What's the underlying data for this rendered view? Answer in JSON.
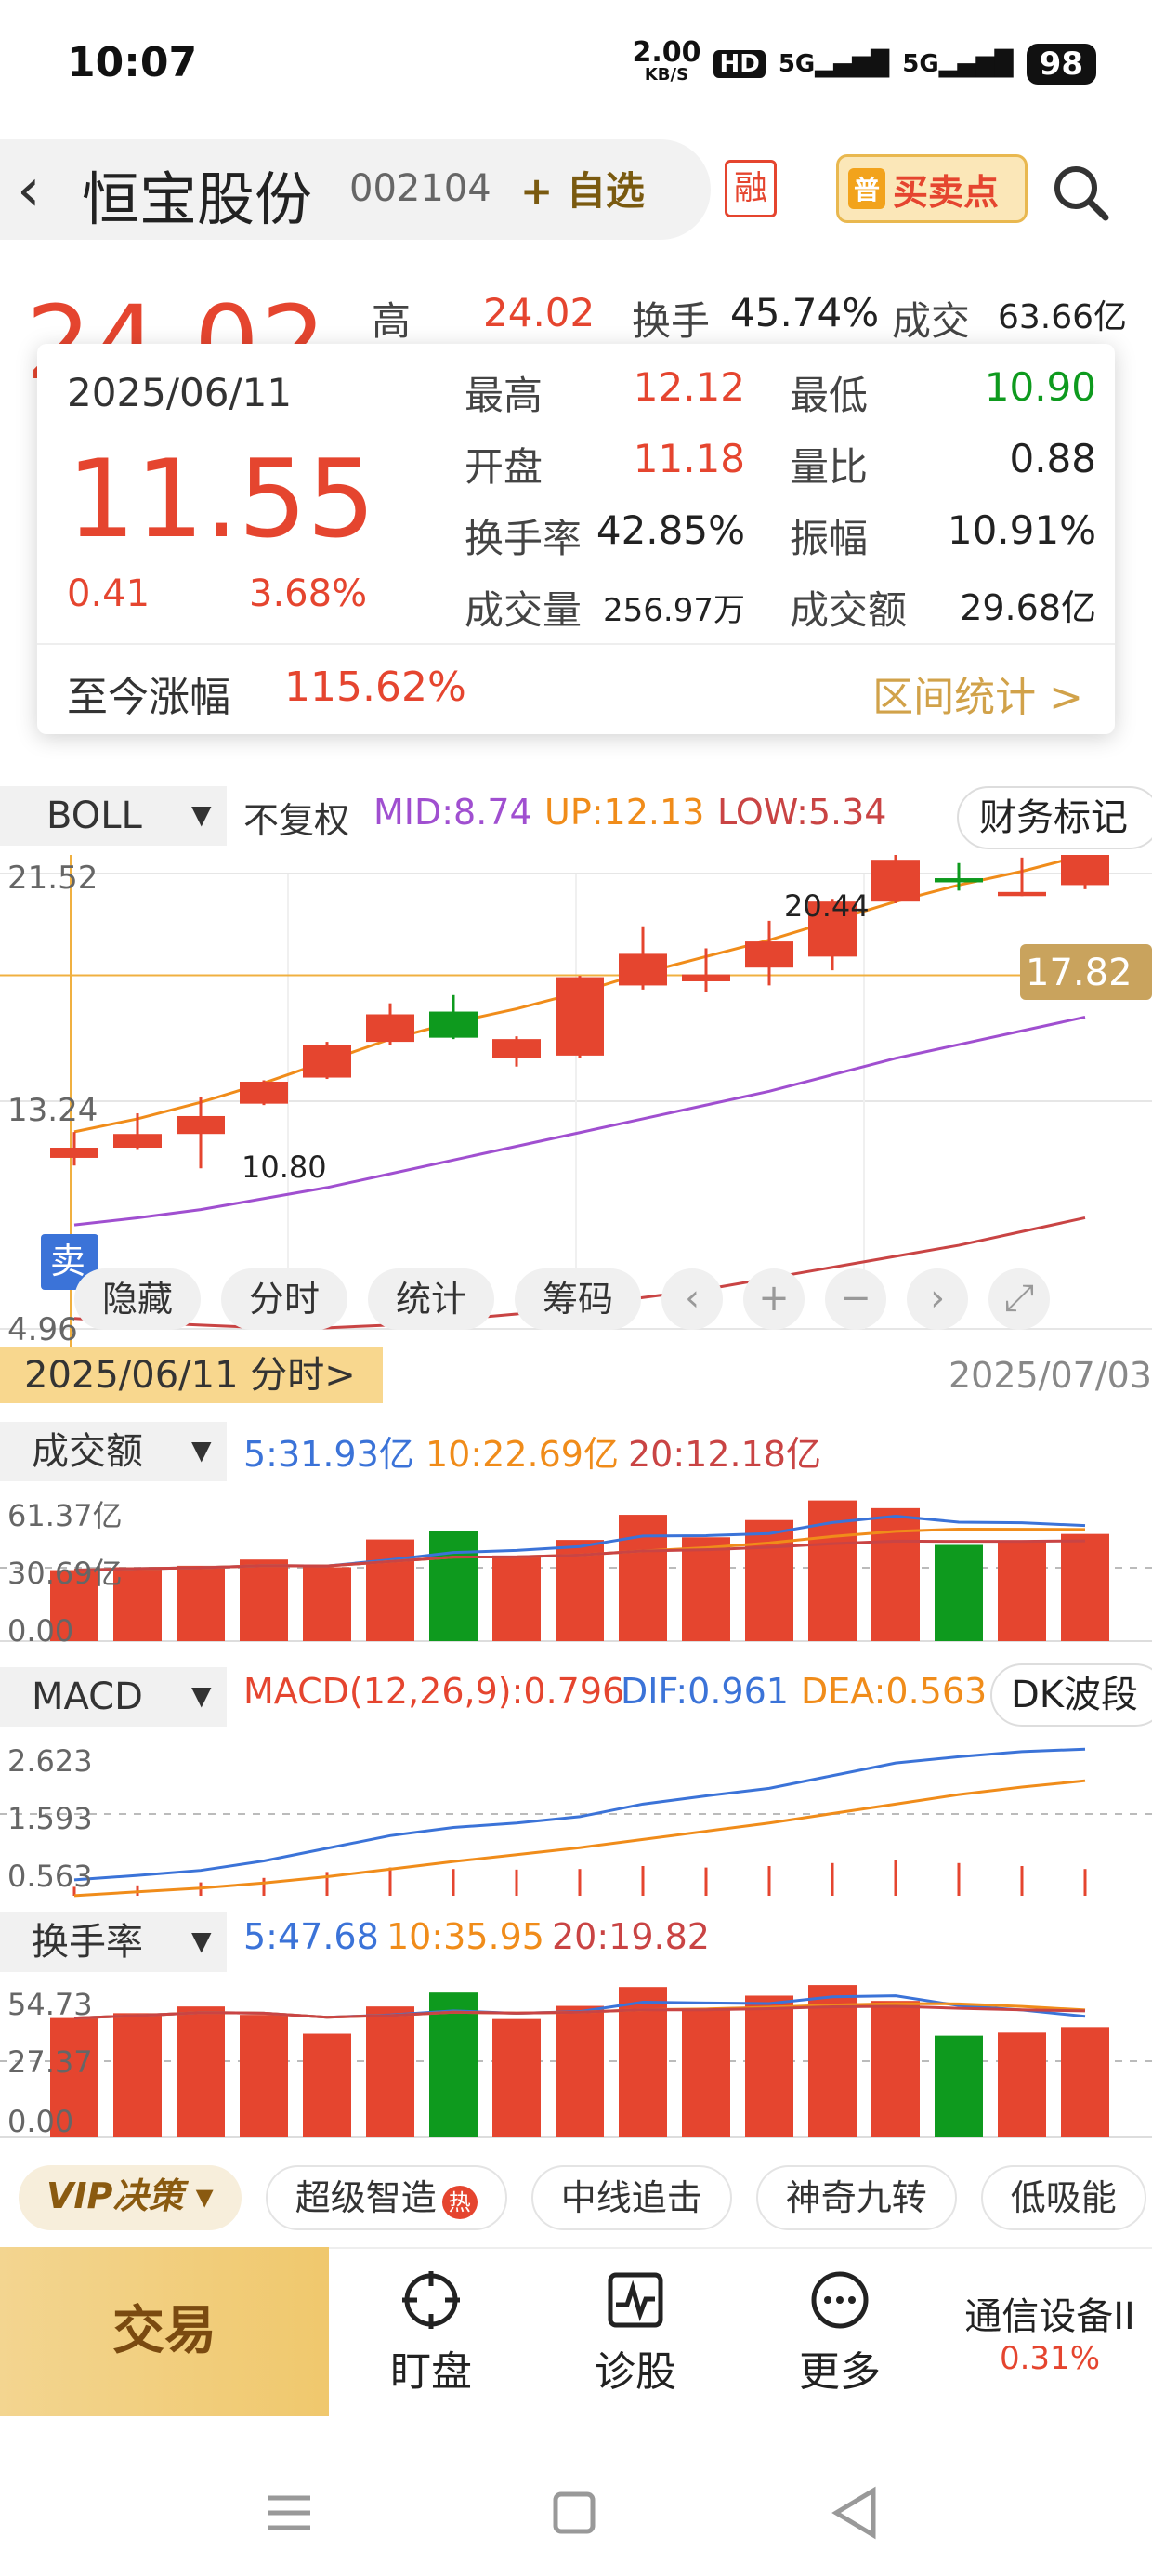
{
  "status": {
    "time": "10:07",
    "net_speed": "2.00",
    "net_unit": "KB/S",
    "hd": "HD",
    "sig1": "5G",
    "sig2": "5G",
    "battery": "98"
  },
  "header": {
    "name": "恒宝股份",
    "code": "002104",
    "watch_label": "+ 自选",
    "rong": "融",
    "buysell_badge": "普",
    "buysell_label": "买卖点"
  },
  "quote": {
    "price_bg": "24.02",
    "high_label": "高",
    "high_value": "24.02",
    "turnover_label": "换手",
    "turnover_value": "45.74%",
    "volume_label": "成交",
    "volume_value": "63.66亿"
  },
  "popup": {
    "date": "2025/06/11",
    "price": "11.55",
    "change": "0.41",
    "change_pct": "3.68%",
    "rows": [
      {
        "l1": "最高",
        "v1": "12.12",
        "l2": "最低",
        "v2": "10.90"
      },
      {
        "l1": "开盘",
        "v1": "11.18",
        "l2": "量比",
        "v2": "0.88"
      },
      {
        "l1": "换手率",
        "v1": "42.85%",
        "l2": "振幅",
        "v2": "10.91%"
      },
      {
        "l1": "成交量",
        "v1": "256.97万",
        "l2": "成交额",
        "v2": "29.68亿"
      }
    ],
    "since_label": "至今涨幅",
    "since_value": "115.62%",
    "range_label": "区间统计 >"
  },
  "indicator": {
    "name": "BOLL",
    "adj": "不复权",
    "mid": "MID:8.74",
    "up": "UP:12.13",
    "low": "LOW:5.34",
    "finance_btn": "财务标记"
  },
  "kline": {
    "y_top": "21.52",
    "y_mid": "13.24",
    "y_bottom": "4.96",
    "high_mark": "20.44",
    "low_mark": "10.80",
    "current_price": "17.82",
    "sell_mark": "卖"
  },
  "controls": [
    "隐藏",
    "分时",
    "统计",
    "筹码"
  ],
  "period": {
    "start_tab": "2025/06/11 分时>",
    "end_date": "2025/07/03"
  },
  "volume_panel": {
    "name": "成交额",
    "ma5": "5:31.93亿",
    "ma10": "10:22.69亿",
    "ma20": "20:12.18亿",
    "y_top": "61.37亿",
    "y_mid": "30.69亿",
    "y_zero": "0.00"
  },
  "macd_panel": {
    "name": "MACD",
    "macd": "MACD(12,26,9):0.796",
    "dif": "DIF:0.961",
    "dea": "DEA:0.563",
    "dk_btn": "DK波段",
    "y_top": "2.623",
    "y_mid": "1.593",
    "y_bottom": "0.563"
  },
  "turnover_panel": {
    "name": "换手率",
    "ma5": "5:47.68",
    "ma10": "10:35.95",
    "ma20": "20:19.82",
    "y_top": "54.73",
    "y_mid": "27.37",
    "y_zero": "0.00"
  },
  "features": {
    "vip": "VIP决策",
    "items": [
      "超级智造",
      "中线追击",
      "神奇九转",
      "低吸能"
    ],
    "hot": "热"
  },
  "bottom_nav": {
    "trade": "交易",
    "items": [
      "盯盘",
      "诊股",
      "更多"
    ],
    "sector_name": "通信设备II",
    "sector_pct": "0.31%"
  },
  "colors": {
    "up": "#e5452f",
    "down": "#0e9a1e",
    "boll_up": "#f08c1a",
    "boll_mid": "#a04fd0",
    "boll_low": "#c94444",
    "ma_blue": "#3b73d8"
  },
  "chart_data": {
    "type": "candlestick",
    "dates": [
      "2025/06/11",
      "2025/07/03"
    ],
    "candles": [
      {
        "o": 11.18,
        "c": 11.55,
        "h": 12.12,
        "l": 10.9
      },
      {
        "o": 11.55,
        "c": 12.05,
        "h": 12.8,
        "l": 11.5
      },
      {
        "o": 12.05,
        "c": 12.7,
        "h": 13.4,
        "l": 10.8
      },
      {
        "o": 13.15,
        "c": 13.95,
        "h": 14.0,
        "l": 13.1
      },
      {
        "o": 14.1,
        "c": 15.3,
        "h": 15.4,
        "l": 14.05
      },
      {
        "o": 15.4,
        "c": 16.4,
        "h": 16.8,
        "l": 15.3
      },
      {
        "o": 16.5,
        "c": 15.55,
        "h": 17.1,
        "l": 15.5
      },
      {
        "o": 14.8,
        "c": 15.5,
        "h": 15.6,
        "l": 14.5
      },
      {
        "o": 14.9,
        "c": 17.75,
        "h": 17.8,
        "l": 14.8
      },
      {
        "o": 17.45,
        "c": 18.6,
        "h": 19.6,
        "l": 17.3
      },
      {
        "o": 17.6,
        "c": 17.85,
        "h": 18.8,
        "l": 17.2
      },
      {
        "o": 18.1,
        "c": 19.05,
        "h": 19.8,
        "l": 17.45
      },
      {
        "o": 18.5,
        "c": 20.5,
        "h": 20.6,
        "l": 18.0
      },
      {
        "o": 20.5,
        "c": 22.02,
        "h": 22.5,
        "l": 20.44
      },
      {
        "o": 21.35,
        "c": 21.2,
        "h": 21.9,
        "l": 20.9
      },
      {
        "o": 20.7,
        "c": 20.85,
        "h": 22.1,
        "l": 20.7
      },
      {
        "o": 21.1,
        "c": 22.25,
        "h": 22.3,
        "l": 20.95
      }
    ],
    "boll_up": [
      12.13,
      12.6,
      13.2,
      13.9,
      14.7,
      15.5,
      16.1,
      16.6,
      17.2,
      17.9,
      18.5,
      19.1,
      19.8,
      20.5,
      21.1,
      21.6,
      22.2
    ],
    "boll_mid": [
      8.74,
      9.0,
      9.3,
      9.7,
      10.1,
      10.6,
      11.1,
      11.6,
      12.1,
      12.6,
      13.1,
      13.6,
      14.2,
      14.8,
      15.3,
      15.8,
      16.3
    ],
    "boll_low": [
      5.34,
      5.2,
      5.1,
      5.0,
      5.0,
      5.1,
      5.3,
      5.5,
      5.8,
      6.1,
      6.4,
      6.8,
      7.2,
      7.6,
      8.0,
      8.5,
      9.0
    ],
    "ylim": [
      4.96,
      21.52
    ],
    "volume": {
      "values": [
        29.68,
        30.9,
        31.5,
        34.1,
        30.9,
        42.5,
        46.2,
        35.8,
        42.3,
        52.8,
        43.4,
        50.6,
        58.8,
        55.6,
        40.2,
        42.1,
        44.8
      ],
      "up": [
        true,
        true,
        true,
        true,
        true,
        true,
        false,
        true,
        true,
        true,
        true,
        true,
        true,
        true,
        false,
        true,
        true
      ],
      "ylim": [
        0,
        61.37
      ]
    },
    "macd": {
      "dif": [
        0.55,
        0.62,
        0.7,
        0.85,
        1.05,
        1.25,
        1.38,
        1.45,
        1.55,
        1.75,
        1.88,
        2.0,
        2.2,
        2.4,
        2.5,
        2.58,
        2.62
      ],
      "dea": [
        0.3,
        0.36,
        0.42,
        0.5,
        0.6,
        0.72,
        0.84,
        0.95,
        1.06,
        1.19,
        1.32,
        1.45,
        1.6,
        1.75,
        1.9,
        2.02,
        2.12
      ],
      "hist": [
        0.3,
        0.35,
        0.45,
        0.6,
        0.8,
        0.95,
        0.9,
        0.88,
        0.9,
        1.0,
        0.95,
        1.0,
        1.1,
        1.2,
        1.1,
        1.0,
        0.9
      ],
      "ylim": [
        0.563,
        2.623
      ]
    },
    "turnover": {
      "values": [
        42.85,
        44.6,
        47.0,
        44.0,
        37.2,
        47.0,
        52.0,
        42.5,
        47.2,
        54.0,
        45.6,
        50.9,
        54.7,
        49.0,
        36.5,
        37.6,
        39.6
      ],
      "up": [
        true,
        true,
        true,
        true,
        true,
        true,
        false,
        true,
        true,
        true,
        true,
        true,
        true,
        true,
        false,
        true,
        true
      ],
      "ylim": [
        0,
        54.73
      ]
    }
  }
}
